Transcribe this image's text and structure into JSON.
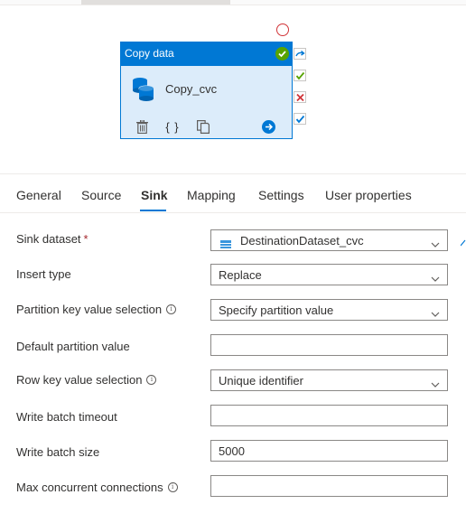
{
  "activity": {
    "type_label": "Copy data",
    "name": "Copy_cvc",
    "code_glyph": "{ }"
  },
  "colors": {
    "accent": "#0078d4",
    "activity_body": "#dcecfa",
    "success": "#57a300",
    "error": "#d13438",
    "required": "#a4262c"
  },
  "tabs": [
    {
      "label": "General",
      "active": false
    },
    {
      "label": "Source",
      "active": false
    },
    {
      "label": "Sink",
      "active": true
    },
    {
      "label": "Mapping",
      "active": false
    },
    {
      "label": "Settings",
      "active": false
    },
    {
      "label": "User properties",
      "active": false
    }
  ],
  "form": {
    "sink_dataset": {
      "label": "Sink dataset",
      "required_mark": "*",
      "value": "DestinationDataset_cvc"
    },
    "insert_type": {
      "label": "Insert type",
      "value": "Replace"
    },
    "partition_key": {
      "label": "Partition key value selection",
      "value": "Specify partition value"
    },
    "default_partition": {
      "label": "Default partition value",
      "value": ""
    },
    "row_key": {
      "label": "Row key value selection",
      "value": "Unique identifier"
    },
    "batch_timeout": {
      "label": "Write batch timeout",
      "value": ""
    },
    "batch_size": {
      "label": "Write batch size",
      "value": "5000"
    },
    "max_connections": {
      "label": "Max concurrent connections",
      "value": ""
    }
  },
  "icons": {
    "info": "info-icon",
    "dropdown": "chevron-down-icon",
    "delete": "trash-icon",
    "code": "code-braces-icon",
    "copy": "copy-icon",
    "go": "arrow-right-circle-icon"
  }
}
